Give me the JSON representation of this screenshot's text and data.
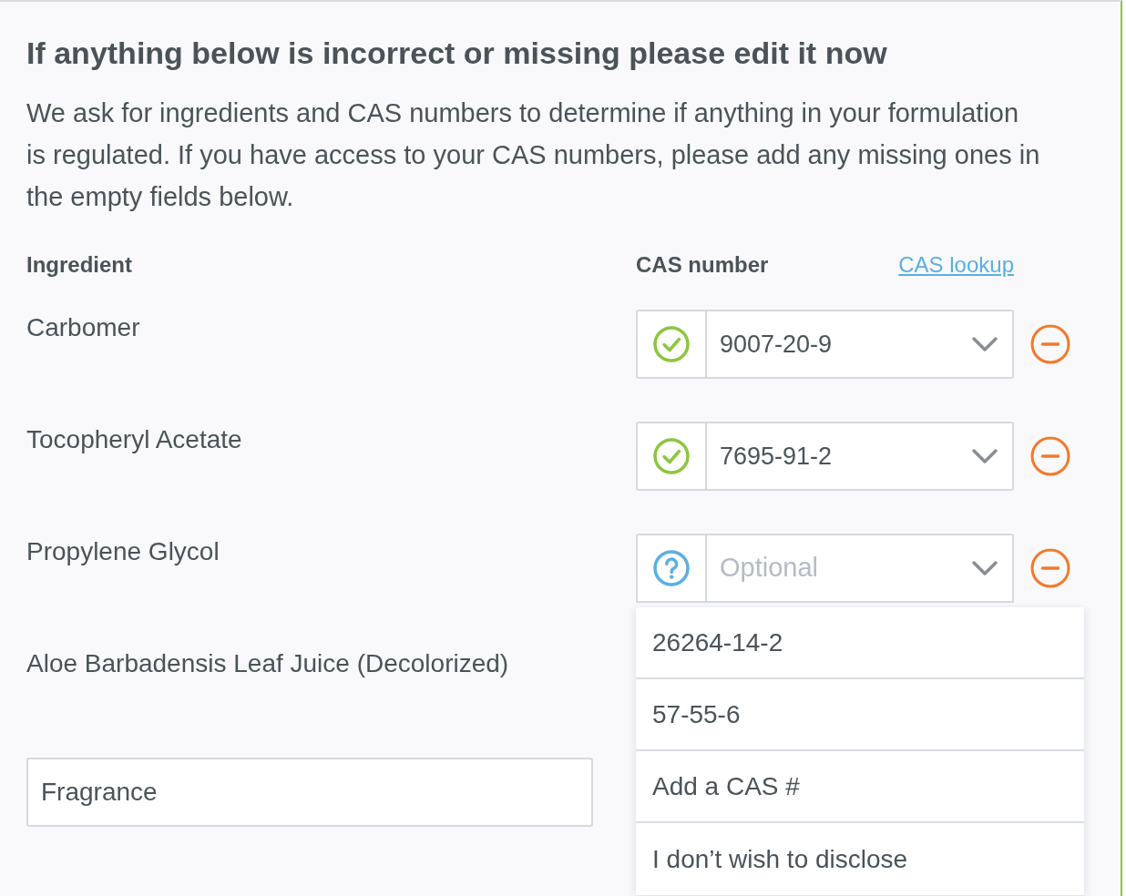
{
  "heading": "If anything below is incorrect or missing please edit it now",
  "intro": "We ask for ingredients and CAS numbers to determine if anything in your formulation is regulated. If you have access to your CAS numbers, please add any missing ones in the empty fields below.",
  "columns": [
    "Ingredient",
    "CAS number"
  ],
  "cas_lookup_link": "CAS lookup",
  "rows": [
    {
      "kind": "label",
      "name": "Carbomer",
      "cas": {
        "verified": true,
        "value": "9007-20-9",
        "expanded": false
      }
    },
    {
      "kind": "label",
      "name": "Tocopheryl Acetate",
      "cas": {
        "verified": true,
        "value": "7695-91-2",
        "expanded": false
      }
    },
    {
      "kind": "label",
      "name": "Propylene Glycol",
      "cas": {
        "verified": false,
        "placeholder": "Optional",
        "expanded": true,
        "options": [
          "26264-14-2",
          "57-55-6",
          "Add a CAS #",
          "I don’t wish to disclose"
        ]
      }
    },
    {
      "kind": "label",
      "name": "Aloe Barbadensis Leaf Juice (Decolorized)"
    },
    {
      "kind": "input",
      "value": "Fragrance"
    }
  ]
}
